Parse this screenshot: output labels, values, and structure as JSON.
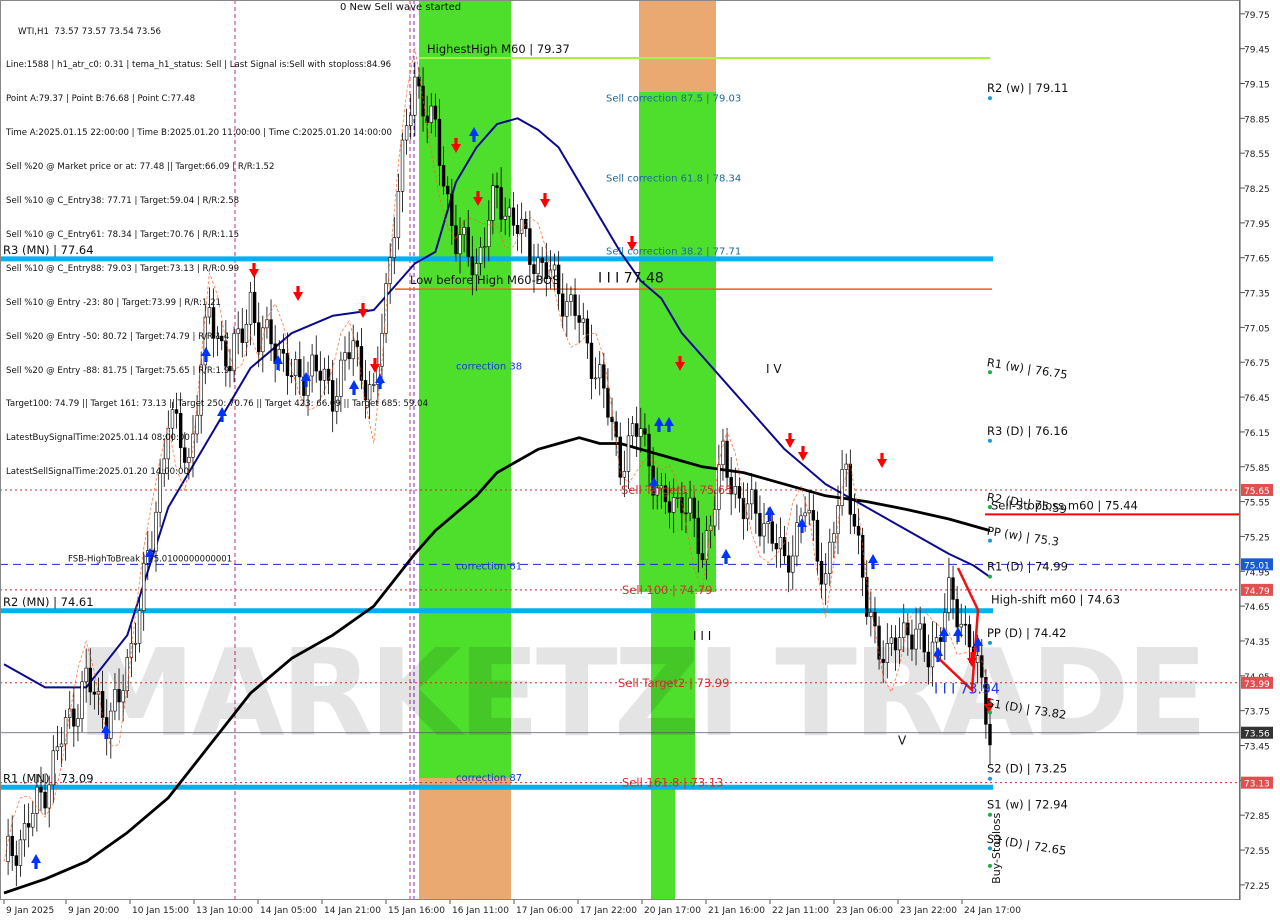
{
  "symbol_header": "WTI,H1  73.57 73.57 73.54 73.56",
  "info_lines": [
    "Line:1588 | h1_atr_c0: 0.31 | tema_h1_status: Sell | Last Signal is:Sell with stoploss:84.96",
    "Point A:79.37 | Point B:76.68 | Point C:77.48",
    "Time A:2025.01.15 22:00:00 | Time B:2025.01.20 11:00:00 | Time C:2025.01.20 14:00:00",
    "Sell %20 @ Market price or at: 77.48 || Target:66.09 | R/R:1.52",
    "Sell %10 @ C_Entry38: 77.71 | Target:59.04 | R/R:2.58",
    "Sell %10 @ C_Entry61: 78.34 | Target:70.76 | R/R:1.15",
    "Sell %10 @ C_Entry88: 79.03 | Target:73.13 | R/R:0.99",
    "Sell %10 @ Entry -23: 80 | Target:73.99 | R/R:1.21",
    "Sell %20 @ Entry -50: 80.72 | Target:74.79 | R/R:1.4",
    "Sell %20 @ Entry -88: 81.75 | Target:75.65 | R/R:1.9",
    "Target100: 74.79 || Target 161: 73.13 || Target 250: 70.76 || Target 423: 66.09 || Target 685: 59.04",
    "LatestBuySignalTime:2025.01.14 08:00:00",
    "LatestSellSignalTime:2025.01.20 14:00:00"
  ],
  "watermark": "MARKETZI TRADE",
  "colors": {
    "background": "#ffffff",
    "level_blue": "#00b0f0",
    "ma_navy": "#0a0a8a",
    "ma_black": "#000000",
    "orange_dash": "#ff5a1a",
    "green_zone": "#44dd22",
    "orange_zone": "#e8a060",
    "sell_red": "#ff0000",
    "buy_blue": "#0033ff",
    "lime": "#a8f048",
    "price_tag_red": "#e05050",
    "price_tag_blue": "#1a5ad8",
    "price_tag_dark": "#333333"
  },
  "chart_data": {
    "type": "line",
    "title": "WTI,H1",
    "y_ticks": [
      "79.75",
      "79.45",
      "79.15",
      "78.85",
      "78.55",
      "78.25",
      "77.95",
      "77.65",
      "77.35",
      "77.05",
      "76.75",
      "76.45",
      "76.15",
      "75.85",
      "75.55",
      "75.25",
      "74.95",
      "74.65",
      "74.35",
      "74.05",
      "73.75",
      "73.45",
      "73.15",
      "72.85",
      "72.55",
      "72.25"
    ],
    "ylim": [
      72.18,
      79.8
    ],
    "x_ticks": [
      "9 Jan 2025",
      "9 Jan 20:00",
      "10 Jan 15:00",
      "13 Jan 10:00",
      "14 Jan 05:00",
      "14 Jan 21:00",
      "15 Jan 16:00",
      "16 Jan 11:00",
      "17 Jan 06:00",
      "17 Jan 22:00",
      "20 Jan 17:00",
      "21 Jan 16:00",
      "22 Jan 11:00",
      "23 Jan 06:00",
      "23 Jan 22:00",
      "24 Jan 17:00"
    ],
    "close_series": {
      "name": "WTI,H1",
      "x_index": [
        0,
        5,
        10,
        15,
        20,
        25,
        28,
        32,
        36,
        40,
        45,
        50,
        55,
        60,
        62,
        65,
        70,
        75,
        80,
        85,
        90,
        95,
        100,
        105,
        110,
        115,
        120,
        125,
        130,
        135,
        140,
        145,
        150,
        155,
        160,
        165,
        170,
        175,
        180,
        185,
        190,
        195,
        200,
        205,
        210,
        215,
        220,
        225,
        230,
        235,
        240
      ],
      "values": [
        72.45,
        72.7,
        73.1,
        73.6,
        74.0,
        73.7,
        73.8,
        74.5,
        75.2,
        76.3,
        75.9,
        77.2,
        76.7,
        77.3,
        76.9,
        77.0,
        76.6,
        76.7,
        76.5,
        76.9,
        76.4,
        78.0,
        79.2,
        78.7,
        77.8,
        77.6,
        78.2,
        77.9,
        77.6,
        77.4,
        77.1,
        76.6,
        75.9,
        76.2,
        75.5,
        75.6,
        75.1,
        75.9,
        75.5,
        75.4,
        75.0,
        75.5,
        74.9,
        75.9,
        74.6,
        74.2,
        74.5,
        74.2,
        74.7,
        74.4,
        73.56
      ]
    },
    "ma_navy_series": {
      "x_index": [
        0,
        10,
        20,
        30,
        40,
        50,
        60,
        70,
        80,
        90,
        100,
        105,
        110,
        115,
        120,
        125,
        130,
        135,
        140,
        145,
        150,
        155,
        160,
        165,
        170,
        180,
        190,
        200,
        210,
        220,
        230,
        236,
        240
      ],
      "values": [
        74.15,
        73.95,
        73.95,
        74.4,
        75.5,
        76.1,
        76.7,
        77.0,
        77.15,
        77.2,
        77.6,
        77.7,
        78.3,
        78.6,
        78.8,
        78.85,
        78.75,
        78.6,
        78.3,
        78.0,
        77.7,
        77.45,
        77.3,
        77.0,
        76.8,
        76.4,
        76.0,
        75.7,
        75.5,
        75.3,
        75.1,
        75.0,
        74.9
      ]
    },
    "ma_black_series": {
      "x_index": [
        0,
        10,
        20,
        30,
        40,
        50,
        60,
        70,
        80,
        90,
        100,
        105,
        110,
        115,
        120,
        125,
        130,
        135,
        140,
        145,
        150,
        155,
        160,
        165,
        170,
        180,
        190,
        200,
        210,
        220,
        230,
        240
      ],
      "values": [
        72.18,
        72.3,
        72.45,
        72.7,
        73.0,
        73.45,
        73.9,
        74.2,
        74.4,
        74.65,
        75.1,
        75.3,
        75.45,
        75.6,
        75.8,
        75.9,
        76.0,
        76.05,
        76.1,
        76.05,
        76.05,
        76.0,
        75.95,
        75.9,
        75.85,
        75.8,
        75.7,
        75.6,
        75.55,
        75.48,
        75.4,
        75.3
      ]
    },
    "horizontal_levels": [
      {
        "label": "R3 (MN) | 77.64",
        "value": 77.64,
        "color": "level_blue",
        "side": "left"
      },
      {
        "label": "R2 (MN) | 74.61",
        "value": 74.61,
        "color": "level_blue",
        "side": "left"
      },
      {
        "label": "R1 (MN) | 73.09",
        "value": 73.09,
        "color": "level_blue",
        "side": "left"
      },
      {
        "label": "HighestHigh   M60 | 79.37",
        "value": 79.37,
        "color": "lime",
        "side": "mid"
      },
      {
        "label": "Low before High   M60-BOS",
        "value": 77.38,
        "color": "orange_dash",
        "side": "mid"
      },
      {
        "label": "FSB-HighToBreak | 75.0100000000001",
        "value": 75.01,
        "color": "navy",
        "side": "left"
      },
      {
        "label": "Sell-Stoploss m60 | 75.44",
        "value": 75.44,
        "color": "sell_red",
        "side": "right"
      },
      {
        "label": "High-shift m60 | 74.63",
        "value": 74.63,
        "color": "none",
        "side": "right"
      }
    ],
    "zone_labels": [
      {
        "text": "Sell correction 87.5 | 79.03",
        "value": 79.03
      },
      {
        "text": "Sell correction 61.8 | 78.34",
        "value": 78.34
      },
      {
        "text": "Sell correction 38.2 | 77.71",
        "value": 77.71
      },
      {
        "text": "correction 38",
        "value": 76.72
      },
      {
        "text": "correction 61",
        "value": 75.0
      },
      {
        "text": "correction 87",
        "value": 73.18
      },
      {
        "text": "Sell Target1 | 75.65",
        "value": 75.65
      },
      {
        "text": "Sell 100 | 74.79",
        "value": 74.79
      },
      {
        "text": "Sell Target2 | 73.99",
        "value": 73.99
      },
      {
        "text": "Sell 161.8 | 73.13",
        "value": 73.13
      }
    ],
    "pivot_labels": [
      {
        "text": "R2 (w) | 79.11",
        "value": 79.11
      },
      {
        "text": "R1 (w) | 76.75",
        "value": 76.75
      },
      {
        "text": "R3 (D) | 76.16",
        "value": 76.16
      },
      {
        "text": "R2 (D) | 75.59",
        "value": 75.59
      },
      {
        "text": "PP (w) | 75.3",
        "value": 75.3
      },
      {
        "text": "R1 (D) | 74.99",
        "value": 74.99
      },
      {
        "text": "PP (D) | 74.42",
        "value": 74.42
      },
      {
        "text": "S1 (D) | 73.82",
        "value": 73.82
      },
      {
        "text": "S2 (D) | 73.25",
        "value": 73.25
      },
      {
        "text": "S1 (w) | 72.94",
        "value": 72.94
      },
      {
        "text": "S3 (D) | 72.65",
        "value": 72.65
      },
      {
        "text": "Buy-Stoploss",
        "value": 72.5
      }
    ],
    "wave_labels": [
      {
        "text": "0 New Sell wave started",
        "value": 79.8
      },
      {
        "text": "I I I 77.48",
        "value": 77.48
      },
      {
        "text": "I V",
        "value": 76.7
      },
      {
        "text": "I I I",
        "value": 74.4
      },
      {
        "text": "I I I 73.94",
        "value": 73.94
      },
      {
        "text": "V",
        "value": 73.5
      }
    ],
    "price_tags": [
      {
        "text": "75.65",
        "value": 75.65,
        "color": "price_tag_red"
      },
      {
        "text": "75.01",
        "value": 75.01,
        "color": "price_tag_blue"
      },
      {
        "text": "74.79",
        "value": 74.79,
        "color": "price_tag_red"
      },
      {
        "text": "73.99",
        "value": 73.99,
        "color": "price_tag_red"
      },
      {
        "text": "73.56",
        "value": 73.56,
        "color": "price_tag_dark"
      },
      {
        "text": "73.13",
        "value": 73.13,
        "color": "price_tag_red"
      }
    ],
    "dotted_levels": [
      75.65,
      74.79,
      73.99,
      73.13
    ],
    "current_price": 73.56,
    "grid": false
  }
}
